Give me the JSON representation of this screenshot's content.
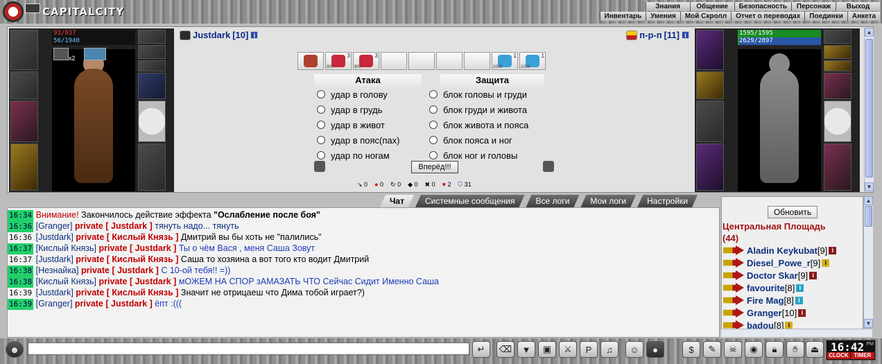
{
  "app": {
    "logo_text": "CAPITALCITY"
  },
  "menu_top": [
    "Знания",
    "Общение",
    "Безопасность",
    "Персонаж",
    "Выход"
  ],
  "menu_bottom": [
    "Инвентарь",
    "Умения",
    "Мой Скролл",
    "Отчет о переводах",
    "Поединки",
    "Анкета"
  ],
  "player_left": {
    "name": "Justdark",
    "level": "[10]",
    "hp": "93/937",
    "mp": "56/1940",
    "buff_count": "x2"
  },
  "player_right": {
    "name": "п-р-п",
    "level": "[11]",
    "hp": "1595/1595",
    "mp": "2629/2897"
  },
  "scrolls": [
    {
      "icon": "sword-scroll-icon",
      "count": "",
      "pts": ""
    },
    {
      "icon": "heart-scroll-icon",
      "count": "3",
      "pts": "900"
    },
    {
      "icon": "heart-scroll-icon",
      "count": "3",
      "pts": "900"
    },
    {
      "icon": "empty-slot-icon",
      "count": "",
      "pts": ""
    },
    {
      "icon": "empty-slot-icon",
      "count": "",
      "pts": ""
    },
    {
      "icon": "empty-slot-icon",
      "count": "",
      "pts": ""
    },
    {
      "icon": "empty-slot-icon",
      "count": "",
      "pts": ""
    },
    {
      "icon": "crystal-scroll-icon",
      "count": "1",
      "pts": "1000"
    },
    {
      "icon": "crystal-scroll-icon",
      "count": "1",
      "pts": "1000"
    }
  ],
  "attack": {
    "title": "Атака",
    "options": [
      "удар в голову",
      "удар в грудь",
      "удар в живот",
      "удар в пояс(пах)",
      "удар по ногам"
    ]
  },
  "defense": {
    "title": "Защита",
    "options": [
      "блок головы и груди",
      "блок груди и живота",
      "блок живота и пояса",
      "блок пояса и ног",
      "блок ног и головы"
    ]
  },
  "go_button": "Вперёд!!!",
  "stats": [
    "0",
    "0",
    "0",
    "0",
    "0",
    "2",
    "31"
  ],
  "tabs": [
    "Чат",
    "Системные сообщения",
    "Все логи",
    "Мои логи",
    "Настройки"
  ],
  "chat": [
    {
      "ts": "16:34",
      "hi": true,
      "parts": [
        {
          "t": "Внимание! ",
          "c": "warn"
        },
        {
          "t": "Закончилось действие эффекта ",
          "c": ""
        },
        {
          "t": "\"Ослабление после боя\"",
          "c": "bold"
        }
      ]
    },
    {
      "ts": "16:36",
      "hi": true,
      "parts": [
        {
          "t": "[Granger] ",
          "c": "nick"
        },
        {
          "t": "private [ Justdark ] ",
          "c": "priv"
        },
        {
          "t": "тянуть надо... тянуть",
          "c": "nick"
        }
      ]
    },
    {
      "ts": "16:36",
      "hi": false,
      "parts": [
        {
          "t": "[Justdark] ",
          "c": "nick"
        },
        {
          "t": "private [ Кислый Князь ] ",
          "c": "priv"
        },
        {
          "t": "Дмитрий вы бы хоть не \"палились\"",
          "c": ""
        }
      ]
    },
    {
      "ts": "16:37",
      "hi": true,
      "parts": [
        {
          "t": "[Кислый Князь] ",
          "c": "nick"
        },
        {
          "t": "private [ Justdark ] ",
          "c": "priv"
        },
        {
          "t": "Ты о чём Вася , меня Саша Зовут",
          "c": "blue"
        }
      ]
    },
    {
      "ts": "16:37",
      "hi": false,
      "parts": [
        {
          "t": "[Justdark] ",
          "c": "nick"
        },
        {
          "t": "private [ Кислый Князь ] ",
          "c": "priv"
        },
        {
          "t": "Саша то хозяина а вот того кто водит Дмитрий",
          "c": ""
        }
      ]
    },
    {
      "ts": "16:38",
      "hi": true,
      "parts": [
        {
          "t": "[Незнайка] ",
          "c": "nick"
        },
        {
          "t": "private [ Justdark ] ",
          "c": "priv"
        },
        {
          "t": "С 10-ой тебя!! =))",
          "c": "blue"
        }
      ]
    },
    {
      "ts": "16:38",
      "hi": true,
      "parts": [
        {
          "t": "[Кислый Князь] ",
          "c": "nick"
        },
        {
          "t": "private [ Justdark ] ",
          "c": "priv"
        },
        {
          "t": "мОЖЕМ НА СПОР зАМАЗАТЬ ЧТО Сейчас Сидит Именно Саша",
          "c": "blue"
        }
      ]
    },
    {
      "ts": "16:39",
      "hi": false,
      "parts": [
        {
          "t": "[Justdark] ",
          "c": "nick"
        },
        {
          "t": "private [ Кислый Князь ] ",
          "c": "priv"
        },
        {
          "t": "Значит не отрицаеш что Дима тобой играет?)",
          "c": ""
        }
      ]
    },
    {
      "ts": "16:39",
      "hi": true,
      "parts": [
        {
          "t": "[Granger] ",
          "c": "nick"
        },
        {
          "t": "private [ Justdark ] ",
          "c": "priv"
        },
        {
          "t": "ёпт :(((",
          "c": "blue"
        }
      ]
    }
  ],
  "online": {
    "refresh": "Обновить",
    "room": "Центральная Площадь",
    "count": "(44)",
    "users": [
      {
        "name": "Aladin Keykubat",
        "lvl": "[9]",
        "info": "red"
      },
      {
        "name": "Diesel_Powe_r",
        "lvl": "[9]",
        "info": "yel"
      },
      {
        "name": "Doctor Skar",
        "lvl": "[9]",
        "info": "red"
      },
      {
        "name": "favourite",
        "lvl": "[8]",
        "info": "cyan"
      },
      {
        "name": "Fire Mag",
        "lvl": "[8]",
        "info": "cyan"
      },
      {
        "name": "Granger",
        "lvl": "[10]",
        "info": "red"
      },
      {
        "name": "badou",
        "lvl": "[8]",
        "info": "yel"
      }
    ]
  },
  "chat_input": {
    "value": "",
    "placeholder": ""
  },
  "clock": {
    "time": "16:42",
    "ampm": "PM",
    "label_left": "CLOCK",
    "label_right": "TIMER"
  }
}
